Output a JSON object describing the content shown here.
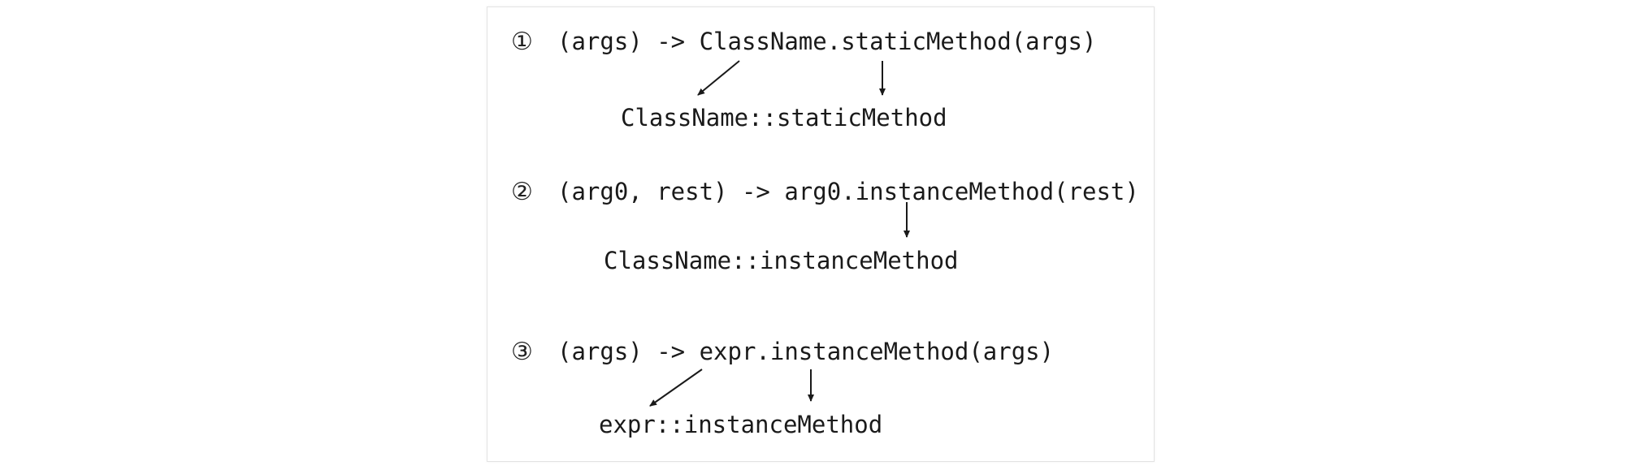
{
  "diagram": {
    "rows": [
      {
        "marker": "①",
        "expression": "(args) -> ClassName.staticMethod(args)",
        "reference": "ClassName::staticMethod"
      },
      {
        "marker": "②",
        "expression": "(arg0, rest) -> arg0.instanceMethod(rest)",
        "reference": "ClassName::instanceMethod"
      },
      {
        "marker": "③",
        "expression": "(args) -> expr.instanceMethod(args)",
        "reference": "expr::instanceMethod"
      }
    ],
    "colors": {
      "text": "#1a1a1a",
      "arrow": "#1a1a1a",
      "border": "#e3e3e3",
      "background": "#ffffff"
    }
  }
}
